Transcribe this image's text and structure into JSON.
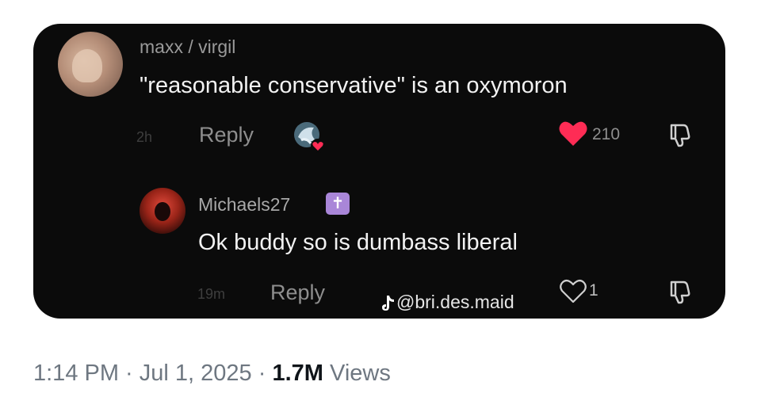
{
  "comment1": {
    "username": "maxx / virgil",
    "text": "\"reasonable conservative\" is an oxymoron",
    "time": "2h",
    "reply_label": "Reply",
    "like_count": "210"
  },
  "comment2": {
    "username": "Michaels27",
    "badge_glyph": "✝",
    "text": "Ok buddy so is dumbass liberal",
    "time": "19m",
    "reply_label": "Reply",
    "like_count": "1"
  },
  "watermark": {
    "handle": "@bri.des.maid"
  },
  "post_footer": {
    "time": "1:14 PM",
    "separator1": " · ",
    "date": "Jul 1, 2025",
    "separator2": " · ",
    "views_count": "1.7M",
    "views_label": " Views"
  },
  "colors": {
    "card_background": "#0b0b0b",
    "like_heart": "#fe2c55",
    "badge": "#a986d8"
  }
}
